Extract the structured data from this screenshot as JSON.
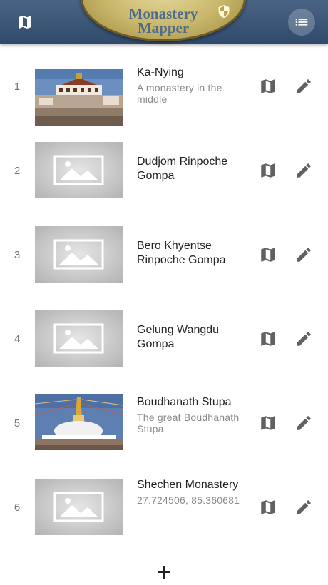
{
  "app": {
    "logo_line1": "Monastery",
    "logo_line2": "Mapper",
    "icons": {
      "map": "map-icon",
      "menu": "list-menu-icon",
      "shield": "shield-icon",
      "edit": "pencil-icon",
      "add": "plus-icon"
    },
    "colors": {
      "appbar": "#3d5678",
      "logo_gold": "#c8b66a",
      "logo_text": "#4e6a8c",
      "icon_gray": "#616161"
    }
  },
  "monasteries": [
    {
      "index": "1",
      "title": "Ka-Nying",
      "description": "A monastery in the middle",
      "image": "photo-ka-nying"
    },
    {
      "index": "2",
      "title": "Dudjom Rinpoche Gompa",
      "description": "",
      "image": "placeholder"
    },
    {
      "index": "3",
      "title": "Bero Khyentse Rinpoche Gompa",
      "description": "",
      "image": "placeholder"
    },
    {
      "index": "4",
      "title": "Gelung Wangdu Gompa",
      "description": "",
      "image": "placeholder"
    },
    {
      "index": "5",
      "title": "Boudhanath Stupa",
      "description": "The great Boudhanath Stupa",
      "image": "photo-boudhanath"
    },
    {
      "index": "6",
      "title": "Shechen Monastery",
      "description": "27.724506, 85.360681",
      "image": "placeholder"
    }
  ],
  "add_label": "+"
}
